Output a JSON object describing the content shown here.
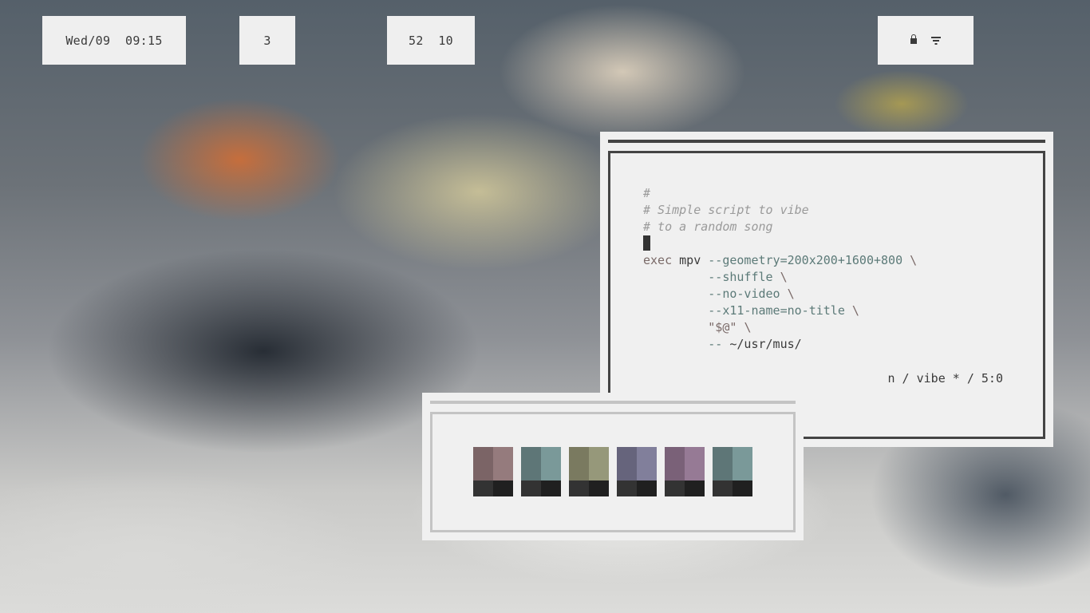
{
  "bar": {
    "clock": {
      "date": "Wed/09",
      "time": "09:15"
    },
    "workspace": "3",
    "stats": {
      "a": "52",
      "b": "10"
    },
    "tray": {
      "icons": [
        "lock-icon",
        "filter-icon"
      ]
    }
  },
  "terminal": {
    "lines": [
      {
        "type": "comment",
        "text": "#"
      },
      {
        "type": "comment",
        "text": "# Simple script to vibe"
      },
      {
        "type": "comment",
        "text": "# to a random song"
      }
    ],
    "exec_keyword": "exec",
    "command": "mpv",
    "arg_geometry": "--geometry=200x200+1600+800",
    "arg_shuffle": "--shuffle",
    "arg_novideo": "--no-video",
    "arg_x11name": "--x11-name=no-title",
    "arg_args": "\"$@\"",
    "arg_dashes": "--",
    "arg_path": "~/usr/mus/",
    "continuation": "\\",
    "status": "n / vibe * / 5:0"
  },
  "palette": {
    "swatches": [
      {
        "top_left": "#7b6466",
        "top_right": "#957b7d",
        "bottom_left": "#333333",
        "bottom_right": "#202020"
      },
      {
        "top_left": "#5e7677",
        "top_right": "#7a9999",
        "bottom_left": "#333333",
        "bottom_right": "#202020"
      },
      {
        "top_left": "#7a7a60",
        "top_right": "#96987a",
        "bottom_left": "#333333",
        "bottom_right": "#202020"
      },
      {
        "top_left": "#66647c",
        "top_right": "#817f9b",
        "bottom_left": "#333333",
        "bottom_right": "#202020"
      },
      {
        "top_left": "#7a6178",
        "top_right": "#967a95",
        "bottom_left": "#333333",
        "bottom_right": "#202020"
      },
      {
        "top_left": "#5e7677",
        "top_right": "#7a9999",
        "bottom_left": "#333333",
        "bottom_right": "#202020"
      }
    ]
  }
}
